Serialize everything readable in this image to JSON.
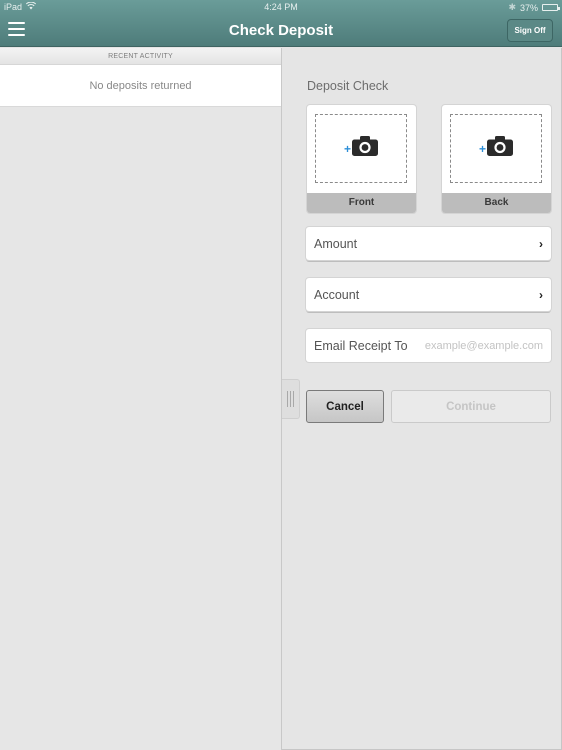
{
  "status_bar": {
    "device": "iPad",
    "time": "4:24 PM",
    "battery_percent": "37%",
    "battery_level": 0.37
  },
  "header": {
    "title": "Check Deposit",
    "sign_off_label": "Sign Off"
  },
  "recent_activity": {
    "header": "RECENT ACTIVITY",
    "empty_message": "No deposits returned"
  },
  "deposit": {
    "title": "Deposit Check",
    "front_label": "Front",
    "back_label": "Back",
    "amount_label": "Amount",
    "account_label": "Account",
    "email_label": "Email Receipt To",
    "email_value": "",
    "email_placeholder": "example@example.com",
    "cancel_label": "Cancel",
    "continue_label": "Continue"
  },
  "icons": {
    "menu": "hamburger-icon",
    "camera": "camera-icon",
    "chevron": "›"
  },
  "colors": {
    "header_bg": "#5f8e8b",
    "plus_accent": "#2d8fd8"
  }
}
